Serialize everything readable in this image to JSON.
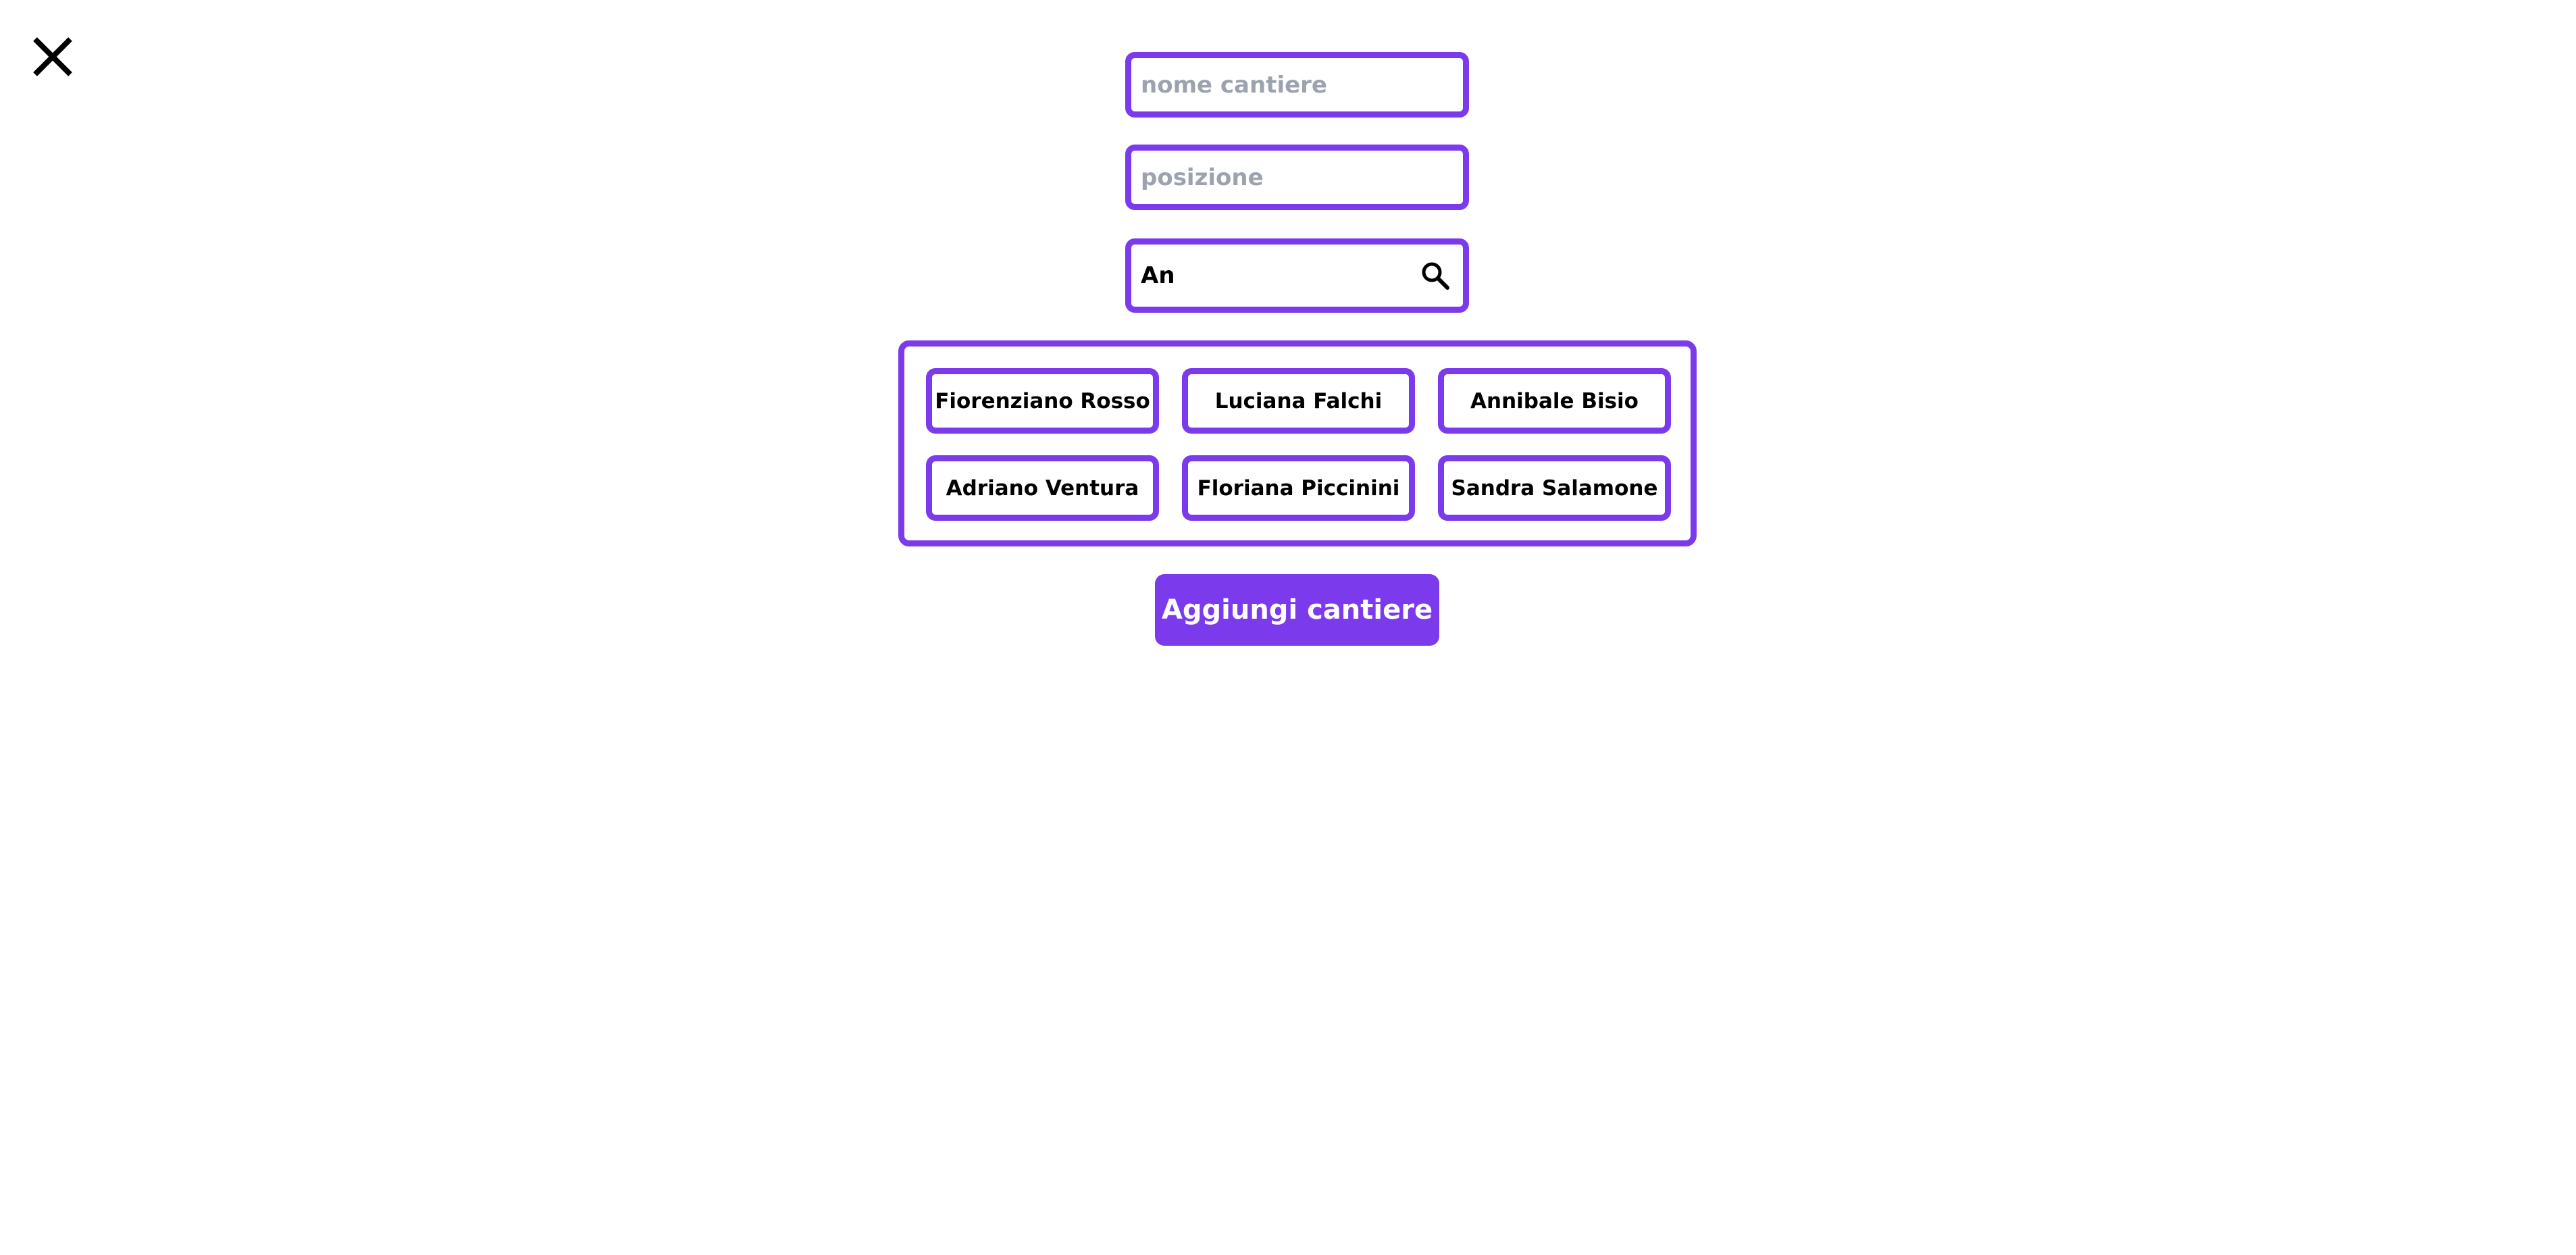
{
  "colors": {
    "accent": "#7c3aed",
    "placeholder": "#9ca3af",
    "text": "#000000",
    "background": "#ffffff"
  },
  "close": {
    "icon": "close-icon"
  },
  "form": {
    "name": {
      "placeholder": "nome cantiere",
      "value": ""
    },
    "position": {
      "placeholder": "posizione",
      "value": ""
    },
    "search": {
      "value": "An",
      "icon": "search-icon"
    }
  },
  "results": [
    {
      "label": "Fiorenziano Rosso"
    },
    {
      "label": "Luciana Falchi"
    },
    {
      "label": "Annibale Bisio"
    },
    {
      "label": "Adriano Ventura"
    },
    {
      "label": "Floriana Piccinini"
    },
    {
      "label": "Sandra Salamone"
    }
  ],
  "submit": {
    "label": "Aggiungi cantiere"
  }
}
